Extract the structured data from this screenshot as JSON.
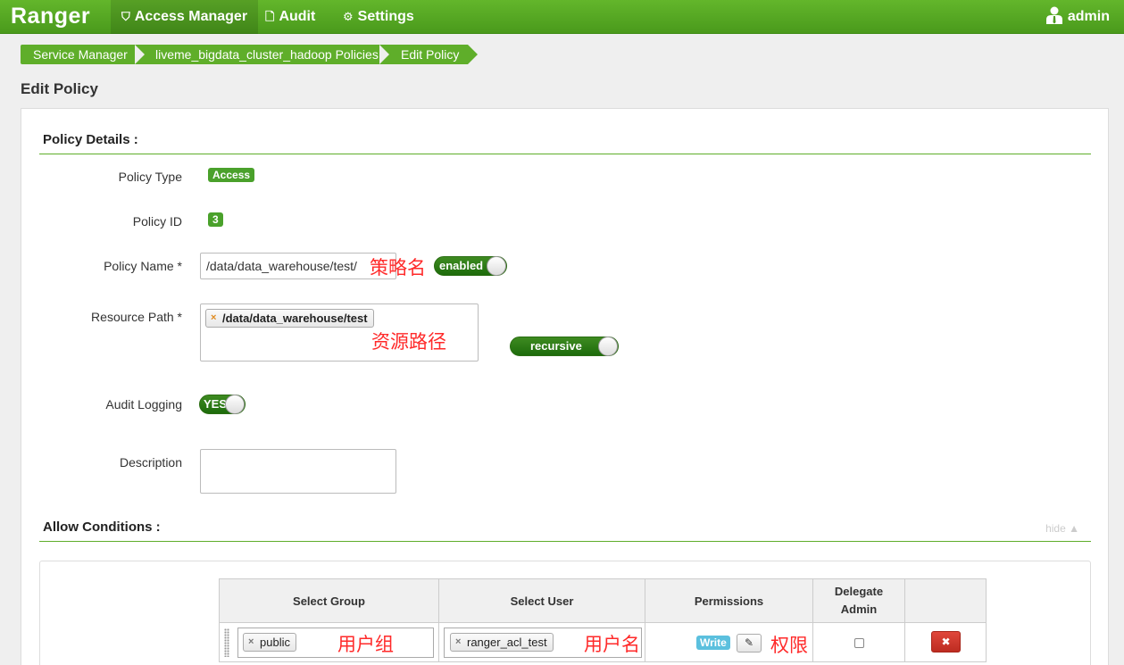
{
  "nav": {
    "brand": "Ranger",
    "items": [
      {
        "label": "Access Manager",
        "icon": "shield-icon"
      },
      {
        "label": "Audit",
        "icon": "file-icon"
      },
      {
        "label": "Settings",
        "icon": "gear-icon"
      }
    ],
    "user": "admin"
  },
  "breadcrumb": [
    "Service Manager",
    "liveme_bigdata_cluster_hadoop Policies",
    "Edit Policy"
  ],
  "page_title": "Edit Policy",
  "policy_details": {
    "title": "Policy Details :",
    "policy_type_label": "Policy Type",
    "policy_type": "Access",
    "policy_id_label": "Policy ID",
    "policy_id": "3",
    "policy_name_label": "Policy Name *",
    "policy_name": "/data/data_warehouse/test/",
    "policy_name_annotation": "策略名",
    "enabled_toggle": "enabled",
    "resource_path_label": "Resource Path *",
    "resource_path": "/data/data_warehouse/test",
    "resource_path_annotation": "资源路径",
    "recursive_toggle": "recursive",
    "audit_logging_label": "Audit Logging",
    "audit_logging": "YES",
    "description_label": "Description",
    "description": ""
  },
  "allow_conditions": {
    "title": "Allow Conditions :",
    "hide_link": "hide ▲",
    "columns": [
      "Select Group",
      "Select User",
      "Permissions",
      "Delegate Admin",
      ""
    ],
    "rows": [
      {
        "group": "public",
        "group_annotation": "用户组",
        "user": "ranger_acl_test",
        "user_annotation": "用户名",
        "permission": "Write",
        "permission_annotation": "权限",
        "delegate_admin": false
      }
    ]
  },
  "colors": {
    "brand_green": "#4a9a1c",
    "accent_green": "#5fae2a",
    "annotation_red": "#ff2a2a",
    "delete_red": "#bd2c21"
  }
}
